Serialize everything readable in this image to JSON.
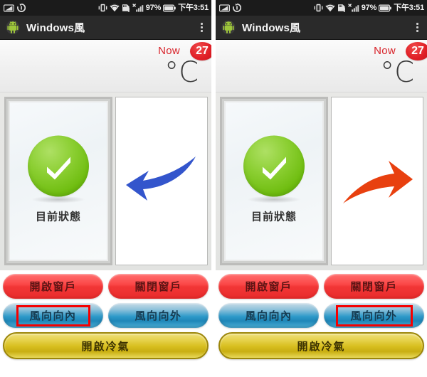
{
  "colors": {
    "accent_red": "#f50000",
    "badge_red": "#e01f26",
    "now_red": "#d8232a",
    "btn_red": "#f23636",
    "btn_blue": "#2e9ac9",
    "btn_gold": "#d8bf20",
    "check_green": "#6fbd10",
    "arrow_blue": "#3355cc",
    "arrow_red": "#e8400f",
    "statusbar_bg": "#1b1b1b",
    "actionbar_bg": "#2a2a2a"
  },
  "statusbar": {
    "icons_left": [
      "sim-card-icon",
      "sync-icon"
    ],
    "icons_right": [
      "vibrate-icon",
      "wifi-icon",
      "sdcard-alert-icon",
      "signal-bars-no-service-icon"
    ],
    "battery_percent": "97%",
    "battery_icon": "battery-full-icon",
    "time": "下午3:51"
  },
  "actionbar": {
    "app_icon": "android-robot-icon",
    "title": "Windows風",
    "overflow_icon": "overflow-menu-icon"
  },
  "weather": {
    "now_label": "Now",
    "temperature": "27",
    "unit": "°C"
  },
  "window_panel": {
    "status_icon": "green-check-circle-icon",
    "status_label": "目前狀態",
    "left_arrow_icon": "curved-arrow-left-icon",
    "right_arrow_icon": "curved-arrow-right-icon"
  },
  "buttons": {
    "open_window": "開啟窗戶",
    "close_window": "關閉窗戶",
    "wind_inward": "風向向內",
    "wind_outward": "風向向外",
    "turn_on_ac": "開啟冷氣"
  },
  "screens": [
    {
      "id": "screen-left",
      "arrow": "curved-arrow-left-icon",
      "arrow_color": "#3355cc",
      "highlighted_button": "風向向內"
    },
    {
      "id": "screen-right",
      "arrow": "curved-arrow-right-icon",
      "arrow_color": "#e8400f",
      "highlighted_button": "風向向外"
    }
  ]
}
